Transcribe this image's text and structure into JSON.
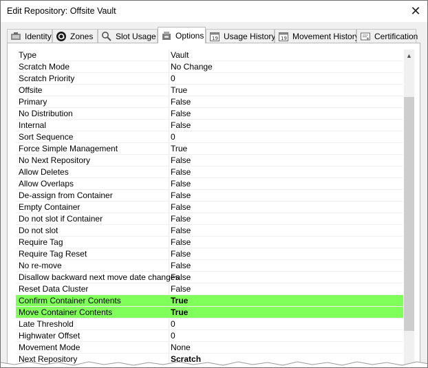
{
  "window": {
    "title": "Edit Repository: Offsite Vault",
    "close_label": "✕"
  },
  "tabs": [
    {
      "id": "identity",
      "label": "Identity",
      "icon": "identity-icon",
      "active": false
    },
    {
      "id": "zones",
      "label": "Zones",
      "icon": "zones-icon",
      "active": false
    },
    {
      "id": "slot-usage",
      "label": "Slot Usage",
      "icon": "magnifier-icon",
      "active": false
    },
    {
      "id": "options",
      "label": "Options",
      "icon": "options-icon",
      "active": true
    },
    {
      "id": "usage-history",
      "label": "Usage History",
      "icon": "calendar-icon",
      "active": false
    },
    {
      "id": "movement-history",
      "label": "Movement History",
      "icon": "calendar-icon",
      "active": false
    },
    {
      "id": "certification",
      "label": "Certification",
      "icon": "certificate-icon",
      "active": false
    }
  ],
  "grid": {
    "highlight_color": "#80ff5a",
    "rows": [
      {
        "name": "Type",
        "value": "Vault"
      },
      {
        "name": "Scratch Mode",
        "value": "No Change"
      },
      {
        "name": "Scratch Priority",
        "value": "0"
      },
      {
        "name": "Offsite",
        "value": "True"
      },
      {
        "name": "Primary",
        "value": "False"
      },
      {
        "name": "No Distribution",
        "value": "False"
      },
      {
        "name": "Internal",
        "value": "False"
      },
      {
        "name": "Sort Sequence",
        "value": "0"
      },
      {
        "name": "Force Simple Management",
        "value": "True"
      },
      {
        "name": "No Next Repository",
        "value": "False"
      },
      {
        "name": "Allow Deletes",
        "value": "False"
      },
      {
        "name": "Allow Overlaps",
        "value": "False"
      },
      {
        "name": "De-assign from Container",
        "value": "False"
      },
      {
        "name": "Empty Container",
        "value": "False"
      },
      {
        "name": "Do not slot if Container",
        "value": "False"
      },
      {
        "name": "Do not slot",
        "value": "False"
      },
      {
        "name": "Require Tag",
        "value": "False"
      },
      {
        "name": "Require Tag Reset",
        "value": "False"
      },
      {
        "name": "No re-move",
        "value": "False"
      },
      {
        "name": "Disallow backward next move date changes",
        "value": "False"
      },
      {
        "name": "Reset Data Cluster",
        "value": "False"
      },
      {
        "name": "Confirm Container Contents",
        "value": "True",
        "highlight": true,
        "bold": true
      },
      {
        "name": "Move Container Contents",
        "value": "True",
        "highlight": true,
        "bold": true
      },
      {
        "name": "Late Threshold",
        "value": "0"
      },
      {
        "name": "Highwater Offset",
        "value": "0"
      },
      {
        "name": "Movement Mode",
        "value": "None"
      },
      {
        "name": "Next Repository",
        "value": "Scratch",
        "bold": true
      }
    ]
  },
  "scrollbar": {
    "up_arrow": "▲"
  }
}
